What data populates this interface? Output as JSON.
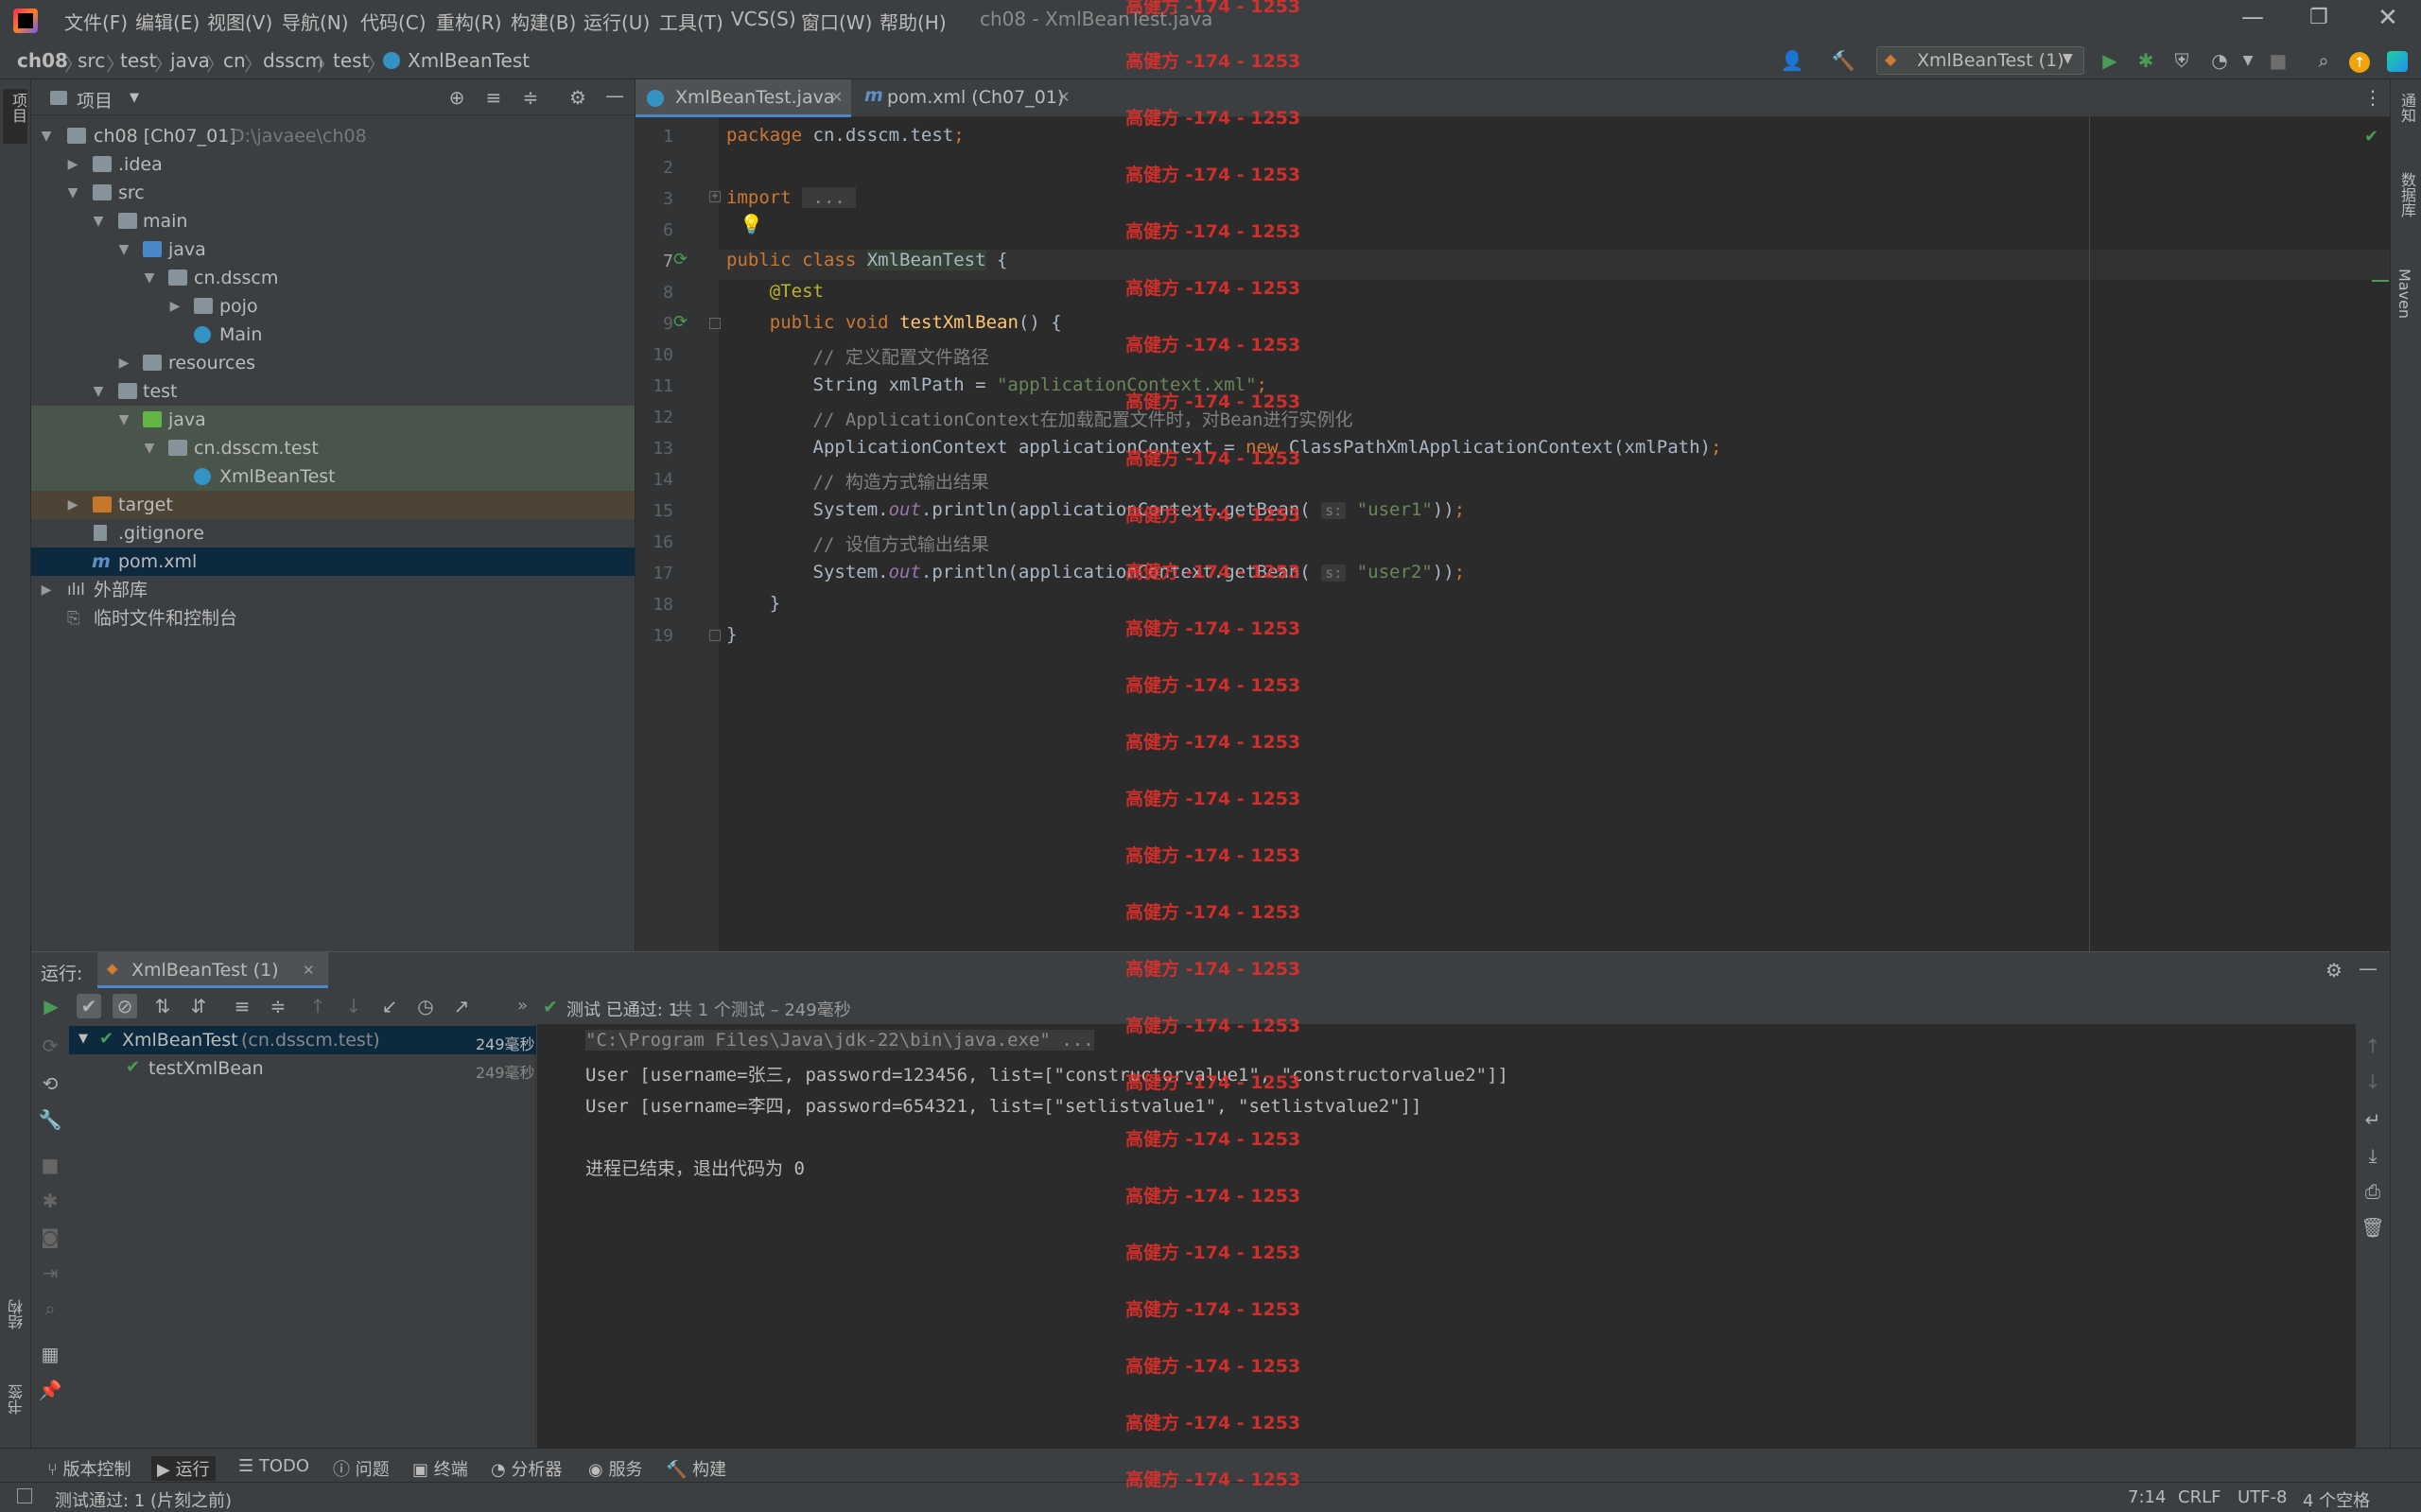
{
  "menubar": {
    "items": [
      "文件(F)",
      "编辑(E)",
      "视图(V)",
      "导航(N)",
      "代码(C)",
      "重构(R)",
      "构建(B)",
      "运行(U)",
      "工具(T)",
      "VCS(S)",
      "窗口(W)",
      "帮助(H)"
    ],
    "window_title": "ch08 - XmlBeanTest.java"
  },
  "breadcrumb": [
    "ch08",
    "src",
    "test",
    "java",
    "cn",
    "dsscm",
    "test",
    "XmlBeanTest"
  ],
  "run_config": "XmlBeanTest (1)",
  "project_panel": {
    "title": "项目",
    "tree": [
      {
        "label": "ch08 [Ch07_01]",
        "extra": "D:\\javaee\\ch08"
      },
      {
        "label": ".idea"
      },
      {
        "label": "src"
      },
      {
        "label": "main"
      },
      {
        "label": "java"
      },
      {
        "label": "cn.dsscm"
      },
      {
        "label": "pojo"
      },
      {
        "label": "Main"
      },
      {
        "label": "resources"
      },
      {
        "label": "test"
      },
      {
        "label": "java"
      },
      {
        "label": "cn.dsscm.test"
      },
      {
        "label": "XmlBeanTest"
      },
      {
        "label": "target"
      },
      {
        "label": ".gitignore"
      },
      {
        "label": "pom.xml"
      },
      {
        "label": "外部库"
      },
      {
        "label": "临时文件和控制台"
      }
    ]
  },
  "editor": {
    "tabs": [
      "XmlBeanTest.java",
      "pom.xml (Ch07_01)"
    ],
    "line_numbers": [
      "1",
      "2",
      "3",
      "6",
      "7",
      "8",
      "9",
      "10",
      "11",
      "12",
      "13",
      "14",
      "15",
      "16",
      "17",
      "18",
      "19"
    ]
  },
  "run_panel": {
    "label": "运行:",
    "tab": "XmlBeanTest (1)",
    "status_prefix": "测试 已通过: 1",
    "status_suffix": "共 1 个测试 – 249毫秒",
    "tests": [
      {
        "name": "XmlBeanTest",
        "pkg": "(cn.dsscm.test)",
        "time": "249毫秒"
      },
      {
        "name": "testXmlBean",
        "pkg": "",
        "time": "249毫秒"
      }
    ],
    "console": [
      "\"C:\\Program Files\\Java\\jdk-22\\bin\\java.exe\" ...",
      "User [username=张三, password=123456, list=[\"constructorvalue1\", \"constructorvalue2\"]]",
      "User [username=李四, password=654321, list=[\"setlistvalue1\", \"setlistvalue2\"]]",
      "",
      "进程已结束，退出代码为 0"
    ]
  },
  "left_strip": {
    "top": "项目",
    "mid": "结构",
    "bottom": "书签"
  },
  "right_strip": {
    "a": "通知",
    "b": "数据库",
    "c": "Maven"
  },
  "bottom_bar": [
    "版本控制",
    "运行",
    "TODO",
    "问题",
    "终端",
    "分析器",
    "服务",
    "构建"
  ],
  "status_bar": {
    "message": "测试通过: 1 (片刻之前)",
    "position": "7:14",
    "line_sep": "CRLF",
    "encoding": "UTF-8",
    "indent": "4 个空格"
  },
  "watermark": "高健方 -174 - 1253",
  "colors": {
    "accent": "#3592c4",
    "pass": "#499c54",
    "watermark": "#e0302b"
  }
}
